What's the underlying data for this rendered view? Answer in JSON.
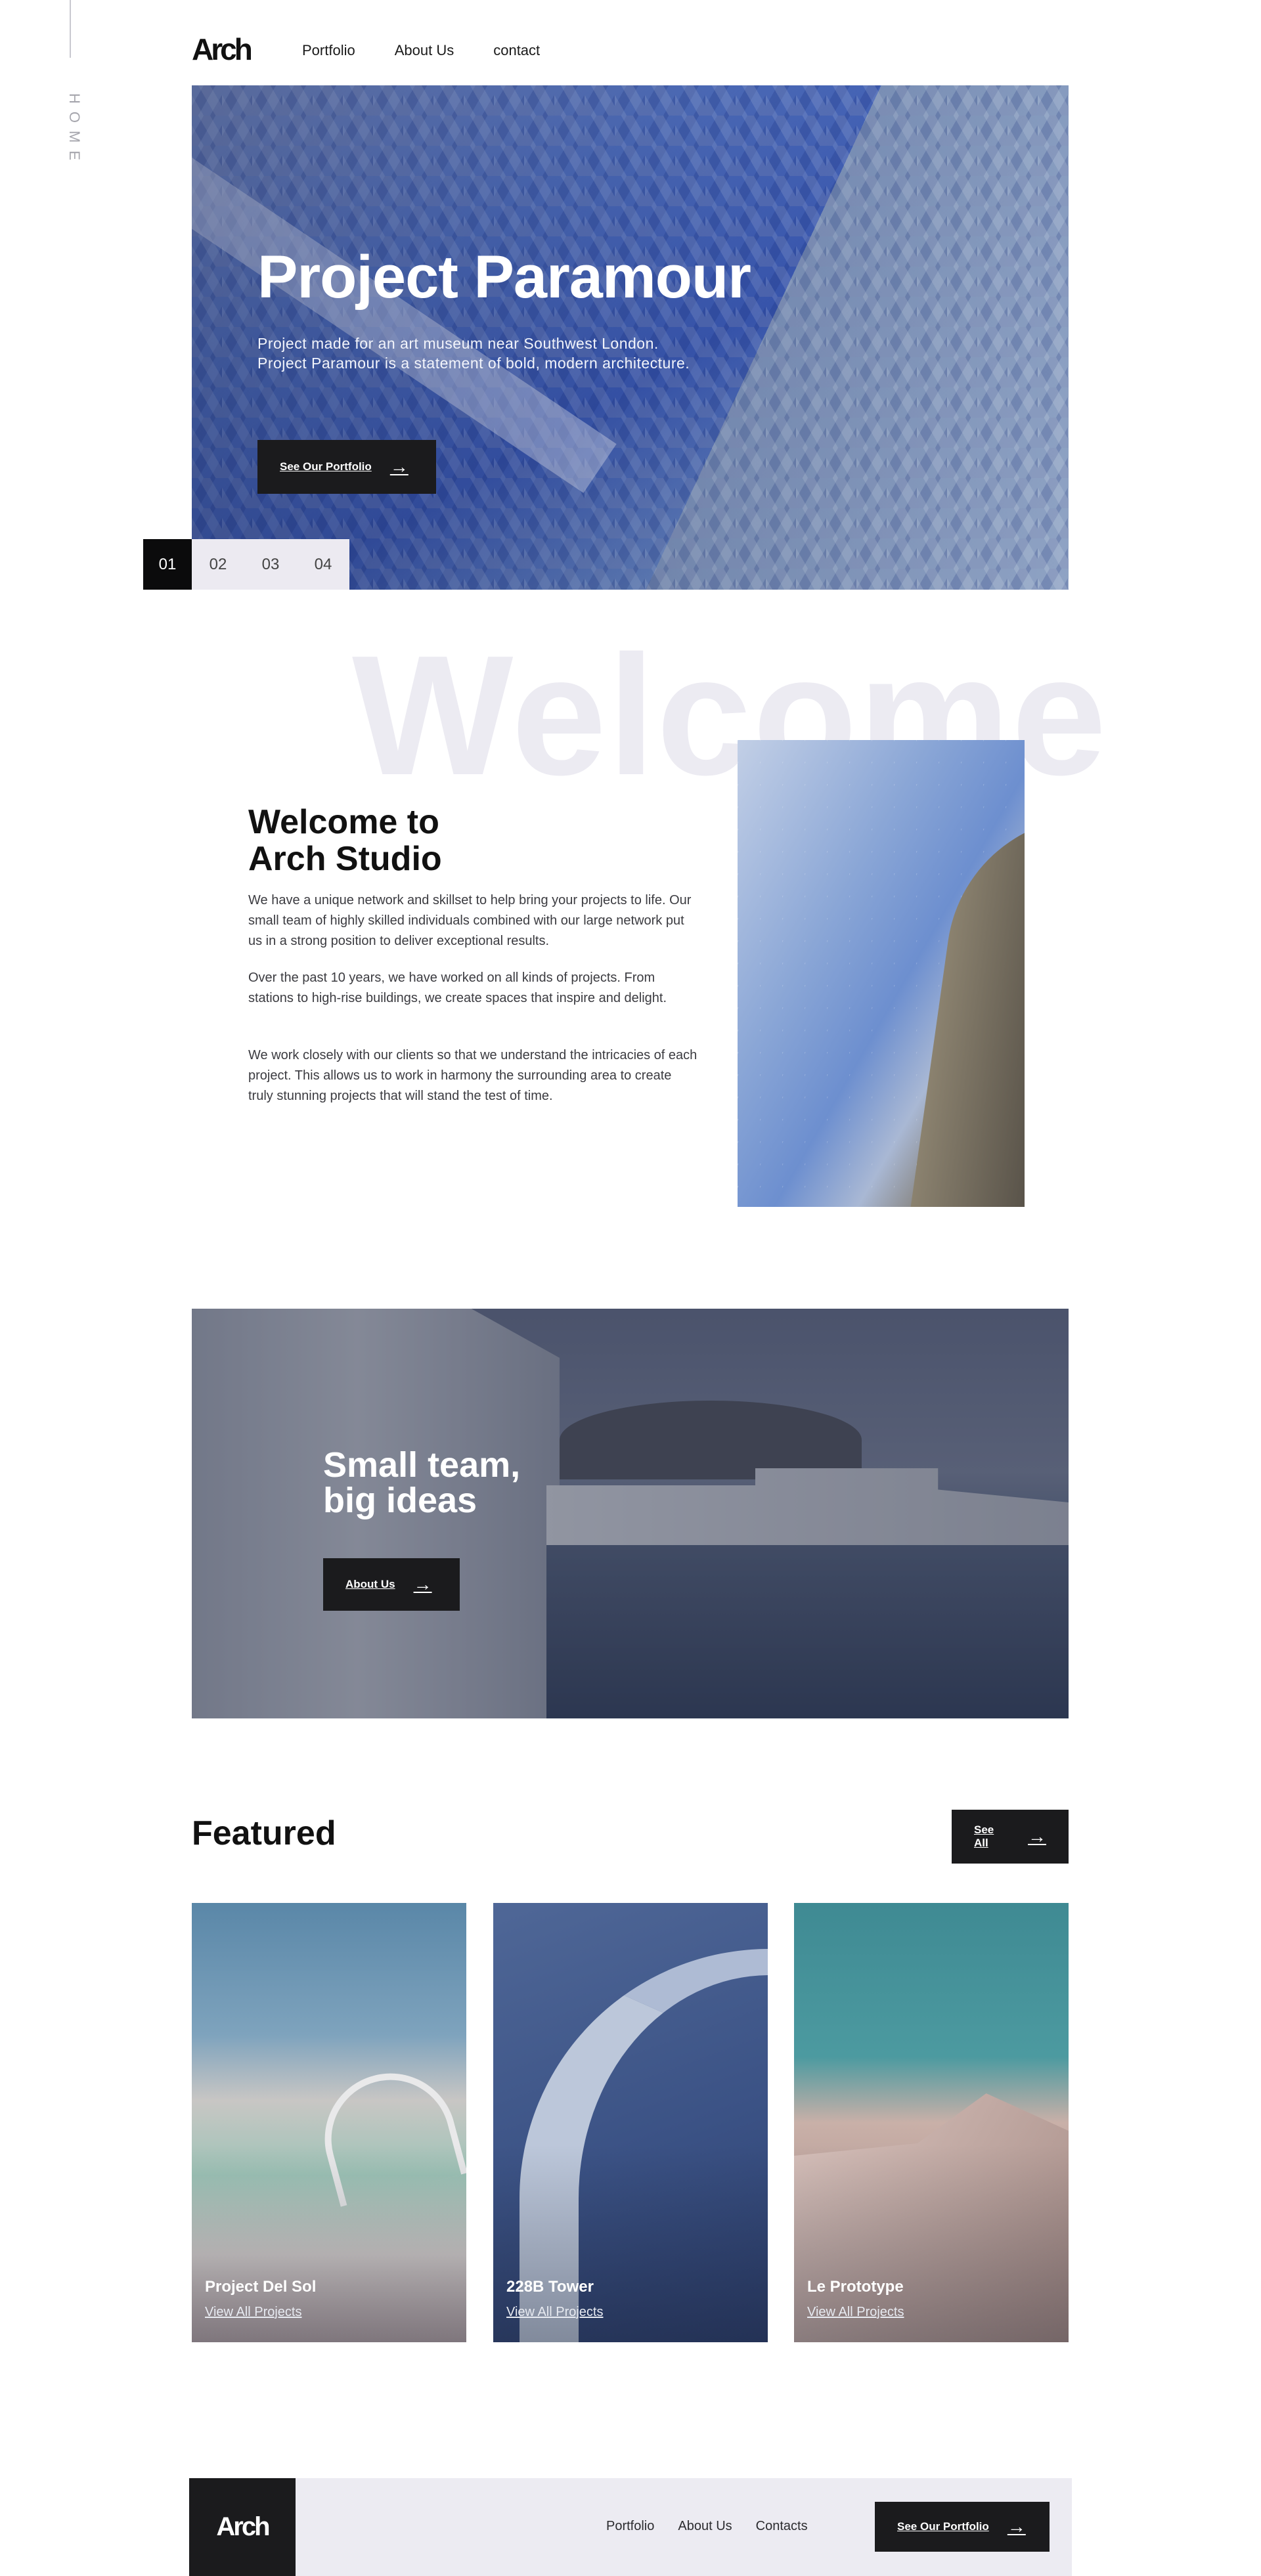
{
  "rail": {
    "label": "HOME"
  },
  "header": {
    "logo": "Arch",
    "nav": [
      "Portfolio",
      "About Us",
      "contact"
    ]
  },
  "hero": {
    "title": "Project Paramour",
    "description": "Project made for an art museum near Southwest London. Project Paramour is a statement of bold, modern architecture.",
    "button": "See Our Portfolio",
    "slides": [
      "01",
      "02",
      "03",
      "04"
    ],
    "active_slide": "01"
  },
  "welcome": {
    "background_word": "Welcome",
    "heading_line1": "Welcome to",
    "heading_line2": "Arch Studio",
    "paragraphs": [
      "We have a unique network and skillset to help bring your projects to life. Our small team of highly skilled individuals combined with our large network put us in a strong position to deliver exceptional results.",
      "Over the past 10 years, we have worked on all kinds of projects. From stations to high-rise buildings, we create spaces that inspire and delight.",
      "We work closely with our clients so that we understand the intricacies of each project. This allows us to work in harmony the surrounding area to create truly stunning projects that will stand the test of time."
    ]
  },
  "team": {
    "title_line1": "Small team,",
    "title_line2": "big ideas",
    "button": "About Us"
  },
  "featured": {
    "heading": "Featured",
    "button": "See All",
    "cards": [
      {
        "title": "Project Del Sol",
        "link": "View All Projects"
      },
      {
        "title": "228B Tower",
        "link": "View All Projects"
      },
      {
        "title": "Le Prototype",
        "link": "View All Projects"
      }
    ]
  },
  "footer": {
    "logo": "Arch",
    "nav": [
      "Portfolio",
      "About Us",
      "Contacts"
    ],
    "button": "See Our Portfolio"
  },
  "icons": {
    "arrow": "arrow-right-icon"
  },
  "colors": {
    "dark": "#1b1b1d",
    "light_bg": "#ecebf2",
    "white": "#ffffff"
  }
}
